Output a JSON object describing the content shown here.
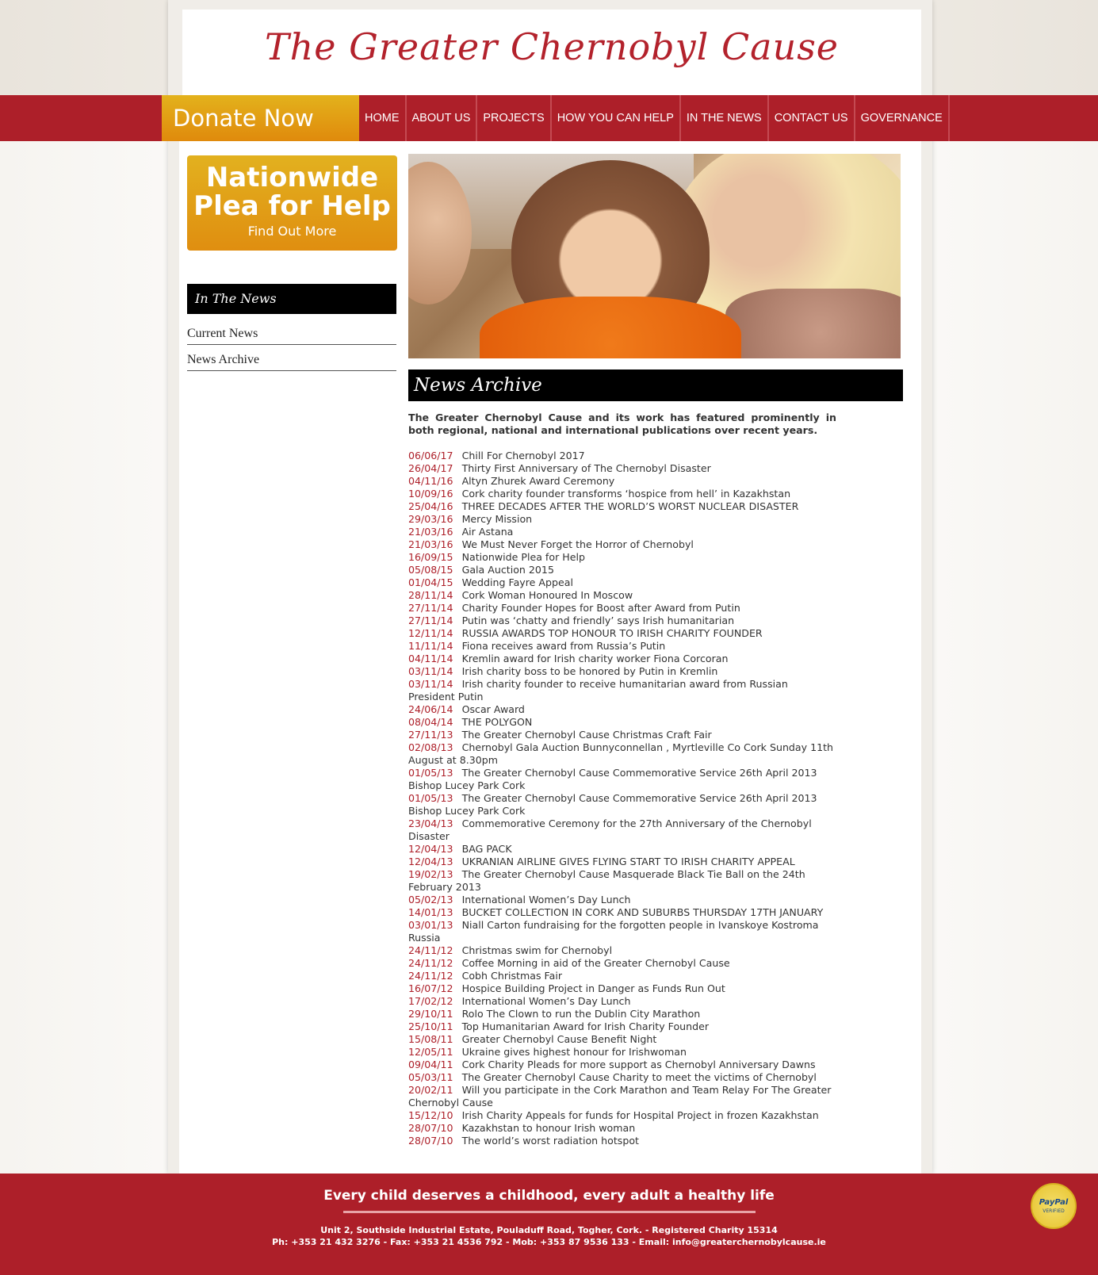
{
  "site": {
    "title": "The Greater Chernobyl Cause"
  },
  "nav": {
    "donate_label": "Donate Now",
    "items": [
      "HOME",
      "ABOUT US",
      "PROJECTS",
      "HOW YOU CAN HELP",
      "IN THE NEWS",
      "CONTACT US",
      "GOVERNANCE"
    ]
  },
  "sidebar": {
    "promo": {
      "line1": "Nationwide",
      "line2": "Plea for Help",
      "cta": "Find Out More"
    },
    "heading": "In The News",
    "links": [
      "Current News",
      "News Archive"
    ]
  },
  "main": {
    "heading": "News Archive",
    "intro": "The Greater Chernobyl Cause and its work has featured prominently in both regional, national and international publications over recent years.",
    "news": [
      {
        "date": "06/06/17",
        "title": "Chill For Chernobyl 2017"
      },
      {
        "date": "26/04/17",
        "title": "Thirty First Anniversary of The Chernobyl Disaster"
      },
      {
        "date": "04/11/16",
        "title": "Altyn Zhurek Award Ceremony"
      },
      {
        "date": "10/09/16",
        "title": "Cork charity founder transforms ‘hospice from hell’ in Kazakhstan"
      },
      {
        "date": "25/04/16",
        "title": "THREE DECADES AFTER THE WORLD’S WORST NUCLEAR DISASTER"
      },
      {
        "date": "29/03/16",
        "title": "Mercy Mission"
      },
      {
        "date": "21/03/16",
        "title": "Air Astana"
      },
      {
        "date": "21/03/16",
        "title": "We Must Never Forget the Horror of Chernobyl"
      },
      {
        "date": "16/09/15",
        "title": "Nationwide Plea for Help"
      },
      {
        "date": "05/08/15",
        "title": "Gala Auction 2015"
      },
      {
        "date": "01/04/15",
        "title": "Wedding Fayre Appeal"
      },
      {
        "date": "28/11/14",
        "title": "Cork Woman Honoured In Moscow"
      },
      {
        "date": "27/11/14",
        "title": "Charity Founder Hopes for Boost after Award from Putin"
      },
      {
        "date": "27/11/14",
        "title": "Putin was ‘chatty and friendly’ says Irish humanitarian"
      },
      {
        "date": "12/11/14",
        "title": "RUSSIA AWARDS TOP HONOUR TO IRISH CHARITY FOUNDER"
      },
      {
        "date": "11/11/14",
        "title": "Fiona receives award from Russia’s Putin"
      },
      {
        "date": "04/11/14",
        "title": "Kremlin award for Irish charity worker Fiona Corcoran"
      },
      {
        "date": "03/11/14",
        "title": "Irish charity boss to be honored by Putin in Kremlin"
      },
      {
        "date": "03/11/14",
        "title": "Irish charity founder to receive humanitarian award from Russian President Putin"
      },
      {
        "date": "24/06/14",
        "title": "Oscar Award"
      },
      {
        "date": "08/04/14",
        "title": "THE POLYGON"
      },
      {
        "date": "27/11/13",
        "title": "The Greater Chernobyl Cause Christmas Craft Fair"
      },
      {
        "date": "02/08/13",
        "title": "Chernobyl Gala Auction Bunnyconnellan , Myrtleville Co Cork Sunday 11th August at 8.30pm"
      },
      {
        "date": "01/05/13",
        "title": "The Greater Chernobyl Cause Commemorative Service 26th April 2013 Bishop Lucey Park Cork"
      },
      {
        "date": "01/05/13",
        "title": "The Greater Chernobyl Cause Commemorative Service 26th April 2013 Bishop Lucey Park Cork"
      },
      {
        "date": "23/04/13",
        "title": "Commemorative Ceremony for the 27th Anniversary of the Chernobyl Disaster"
      },
      {
        "date": "12/04/13",
        "title": "BAG PACK"
      },
      {
        "date": "12/04/13",
        "title": "UKRANIAN AIRLINE GIVES FLYING START TO IRISH CHARITY APPEAL"
      },
      {
        "date": "19/02/13",
        "title": "The Greater Chernobyl Cause Masquerade Black Tie Ball on the 24th February 2013"
      },
      {
        "date": "05/02/13",
        "title": "International Women’s Day Lunch"
      },
      {
        "date": "14/01/13",
        "title": "BUCKET COLLECTION IN CORK AND SUBURBS THURSDAY 17TH JANUARY"
      },
      {
        "date": "03/01/13",
        "title": "Niall Carton fundraising for the forgotten people in Ivanskoye Kostroma Russia"
      },
      {
        "date": "24/11/12",
        "title": "Christmas swim for Chernobyl"
      },
      {
        "date": "24/11/12",
        "title": "Coffee Morning in aid of the Greater Chernobyl Cause"
      },
      {
        "date": "24/11/12",
        "title": "Cobh Christmas Fair"
      },
      {
        "date": "16/07/12",
        "title": "Hospice Building Project in Danger as Funds Run Out"
      },
      {
        "date": "17/02/12",
        "title": "International Women’s Day Lunch"
      },
      {
        "date": "29/10/11",
        "title": "Rolo The Clown to run the Dublin City Marathon"
      },
      {
        "date": "25/10/11",
        "title": "Top Humanitarian Award for Irish Charity Founder"
      },
      {
        "date": "15/08/11",
        "title": "Greater Chernobyl Cause Benefit Night"
      },
      {
        "date": "12/05/11",
        "title": "Ukraine gives highest honour for Irishwoman"
      },
      {
        "date": "09/04/11",
        "title": "Cork Charity Pleads for more support as Chernobyl Anniversary Dawns"
      },
      {
        "date": "05/03/11",
        "title": "The Greater Chernobyl Cause Charity to meet the victims of Chernobyl"
      },
      {
        "date": "20/02/11",
        "title": "Will you participate in the Cork Marathon and Team Relay For The Greater Chernobyl Cause"
      },
      {
        "date": "15/12/10",
        "title": "Irish Charity Appeals for funds for Hospital Project in frozen Kazakhstan"
      },
      {
        "date": "28/07/10",
        "title": "Kazakhstan to honour Irish woman"
      },
      {
        "date": "28/07/10",
        "title": "The world’s worst radiation hotspot"
      }
    ]
  },
  "footer": {
    "tagline": "Every child deserves a childhood, every adult a healthy life",
    "address": "Unit 2, Southside Industrial Estate, Pouladuff Road, Togher, Cork. - Registered Charity 15314",
    "contact": "Ph: +353 21 432 3276 - Fax: +353 21 4536 792 - Mob: +353 87 9536 133 - Email: info@greaterchernobylcause.ie",
    "badge_line1": "PayPal",
    "badge_line2": "VERIFIED"
  }
}
